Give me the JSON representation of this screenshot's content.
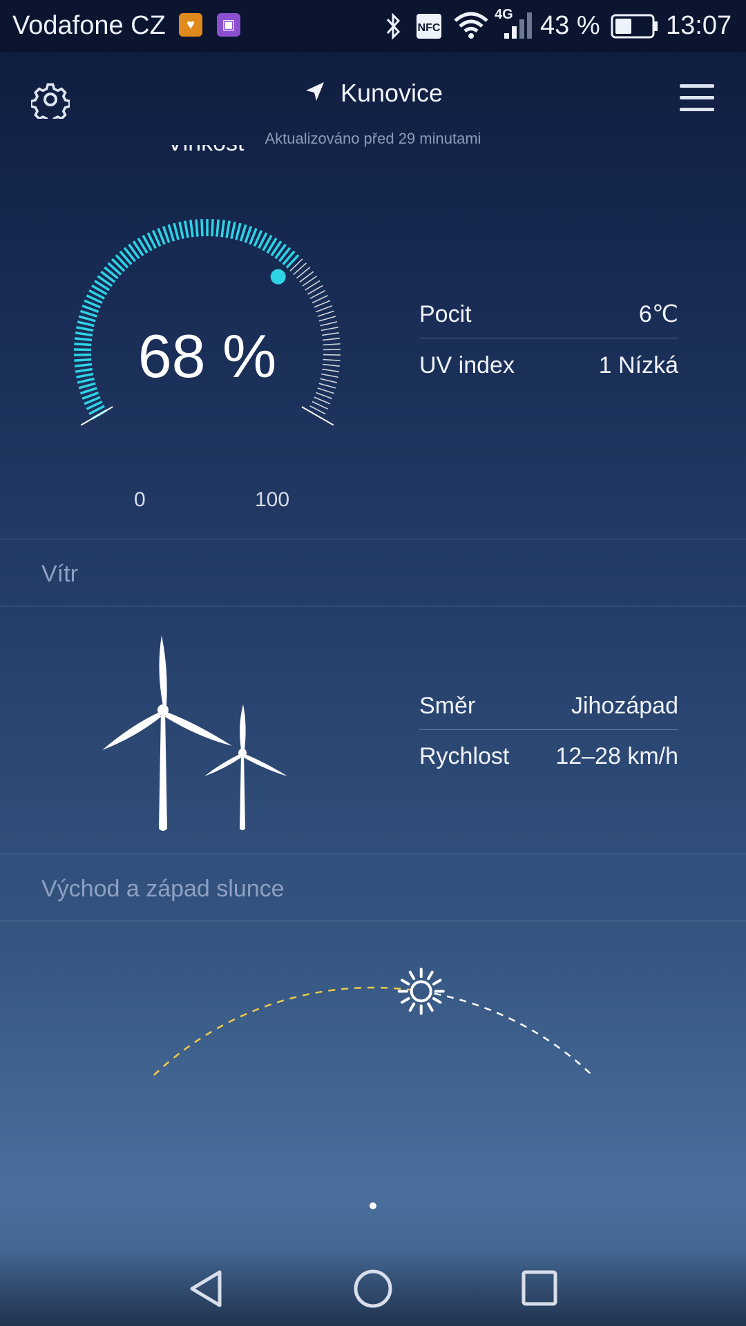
{
  "status_bar": {
    "carrier": "Vodafone CZ",
    "network_badge": "4G",
    "battery": "43 %",
    "time": "13:07",
    "icons": [
      "app-notification-icon",
      "gallery-notification-icon",
      "bluetooth-icon",
      "nfc-icon",
      "wifi-icon",
      "signal-icon",
      "battery-icon"
    ]
  },
  "header": {
    "location": "Kunovice",
    "updated": "Aktualizováno před 29 minutami",
    "icons": [
      "settings-icon",
      "location-arrow-icon",
      "menu-icon"
    ]
  },
  "humidity": {
    "partial_title": "Vlhkost",
    "value_text": "68 %",
    "value": 68,
    "min_label": "0",
    "max_label": "100",
    "accent_color": "#2ed3e6",
    "details": [
      {
        "label": "Pocit",
        "value": "6℃"
      },
      {
        "label": "UV index",
        "value": "1 Nízká"
      }
    ]
  },
  "wind": {
    "title": "Vítr",
    "details": [
      {
        "label": "Směr",
        "value": "Jihozápad"
      },
      {
        "label": "Rychlost",
        "value": "12–28 km/h"
      }
    ],
    "icon": "wind-turbines-icon"
  },
  "sun": {
    "title": "Východ a západ slunce",
    "progress": 0.6,
    "elapsed_color": "#f0c94a",
    "icon": "sun-icon"
  },
  "nav": {
    "icons": [
      "back-icon",
      "home-icon",
      "recents-icon"
    ]
  }
}
